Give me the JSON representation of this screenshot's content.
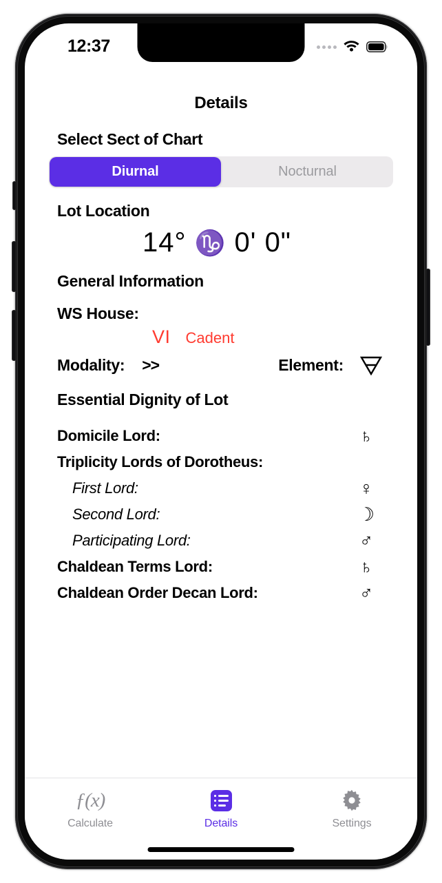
{
  "status_bar": {
    "time": "12:37",
    "signal_icon": "signal-dots-icon",
    "wifi_icon": "wifi-icon",
    "battery_icon": "battery-full-icon"
  },
  "nav": {
    "title": "Details"
  },
  "sect_section": {
    "heading": "Select Sect of Chart",
    "options": [
      {
        "label": "Diurnal",
        "selected": true
      },
      {
        "label": "Nocturnal",
        "selected": false
      }
    ]
  },
  "lot_location": {
    "heading": "Lot Location",
    "degrees": "14°",
    "sign_glyph": "♑",
    "sign_name": "capricorn",
    "minutes": "0'",
    "seconds": "0\"",
    "full_value": "14° ♑ 0' 0\""
  },
  "general_information": {
    "heading": "General Information",
    "ws_house_label": "WS House:",
    "ws_house_roman": "VI",
    "ws_house_quality": "Cadent",
    "modality_label": "Modality:",
    "modality_value": ">>",
    "element_label": "Element:",
    "element_glyph": "earth-triangle-icon"
  },
  "essential_dignity": {
    "heading": "Essential Dignity of Lot",
    "rows": [
      {
        "label": "Domicile Lord:",
        "symbol": "♄",
        "planet": "saturn",
        "style": "bold"
      },
      {
        "label": "Triplicity Lords of Dorotheus:",
        "symbol": "",
        "planet": "",
        "style": "bold"
      },
      {
        "label": "First Lord:",
        "symbol": "♀",
        "planet": "venus",
        "style": "italic"
      },
      {
        "label": "Second Lord:",
        "symbol": "☽",
        "planet": "moon",
        "style": "italic"
      },
      {
        "label": "Participating Lord:",
        "symbol": "♂",
        "planet": "mars",
        "style": "italic"
      },
      {
        "label": "Chaldean Terms Lord:",
        "symbol": "♄",
        "planet": "saturn",
        "style": "bold"
      },
      {
        "label": "Chaldean Order Decan Lord:",
        "symbol": "♂",
        "planet": "mars",
        "style": "bold"
      }
    ]
  },
  "tab_bar": {
    "tabs": [
      {
        "label": "Calculate",
        "icon": "function-fx-icon",
        "active": false
      },
      {
        "label": "Details",
        "icon": "list-bullet-icon",
        "active": true
      },
      {
        "label": "Settings",
        "icon": "gear-icon",
        "active": false
      }
    ]
  },
  "colors": {
    "accent_purple": "#5B2EE5",
    "status_red": "#FF3B30",
    "inactive_gray": "#8E8E93",
    "segment_track": "#ECEAEC"
  }
}
